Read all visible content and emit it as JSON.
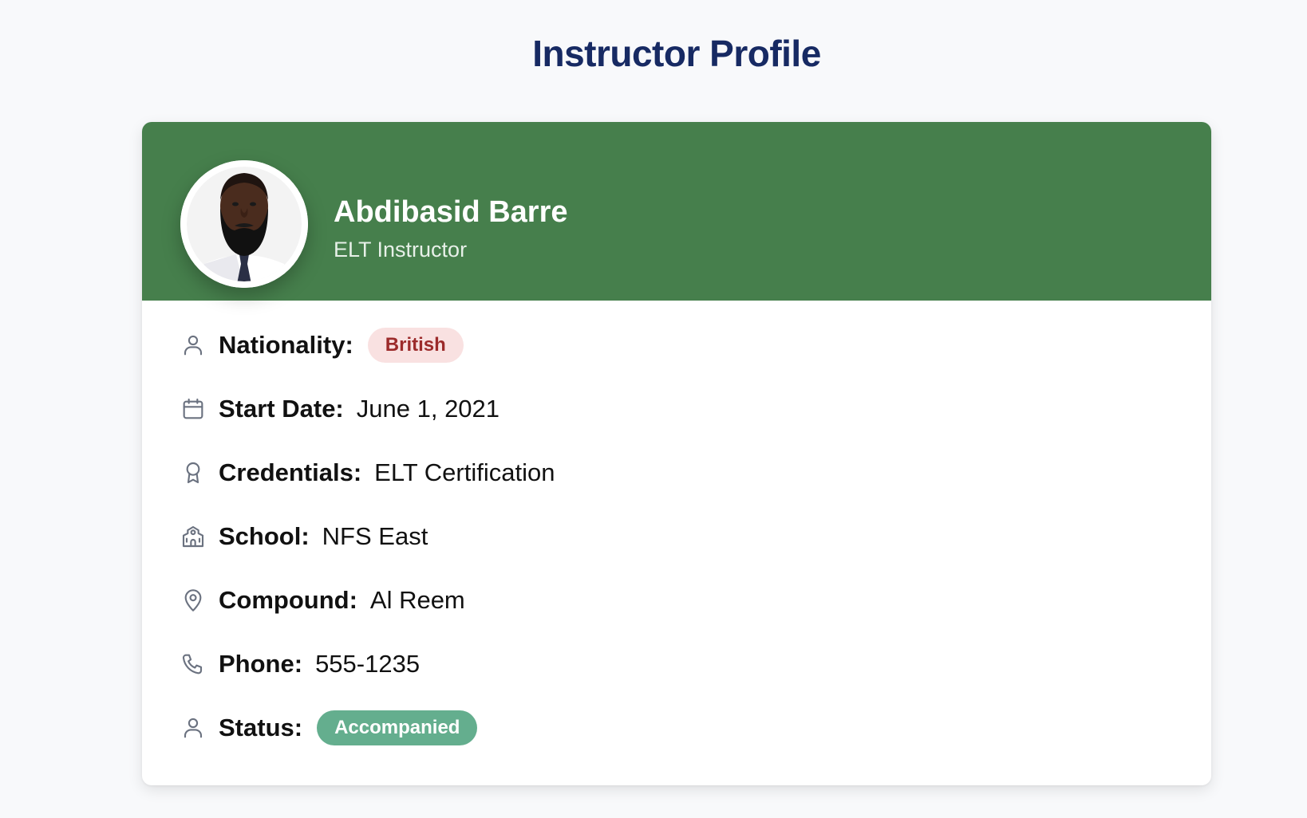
{
  "page": {
    "title": "Instructor Profile"
  },
  "profile": {
    "name": "Abdibasid Barre",
    "role": "ELT Instructor",
    "header_color": "#467f4c"
  },
  "details": [
    {
      "icon": "user-icon",
      "label": "Nationality:",
      "value": "British",
      "badge": true,
      "badge_color": "#f9e1e1"
    },
    {
      "icon": "calendar-icon",
      "label": "Start Date:",
      "value": "June 1, 2021",
      "badge": false
    },
    {
      "icon": "award-icon",
      "label": "Credentials:",
      "value": "ELT Certification",
      "badge": false
    },
    {
      "icon": "school-icon",
      "label": "School:",
      "value": "NFS East",
      "badge": false
    },
    {
      "icon": "map-pin-icon",
      "label": "Compound:",
      "value": "Al Reem",
      "badge": false
    },
    {
      "icon": "phone-icon",
      "label": "Phone:",
      "value": "555-1235",
      "badge": false
    },
    {
      "icon": "user-icon",
      "label": "Status:",
      "value": "Accompanied",
      "badge": true,
      "badge_color": "#64ae8e"
    }
  ]
}
